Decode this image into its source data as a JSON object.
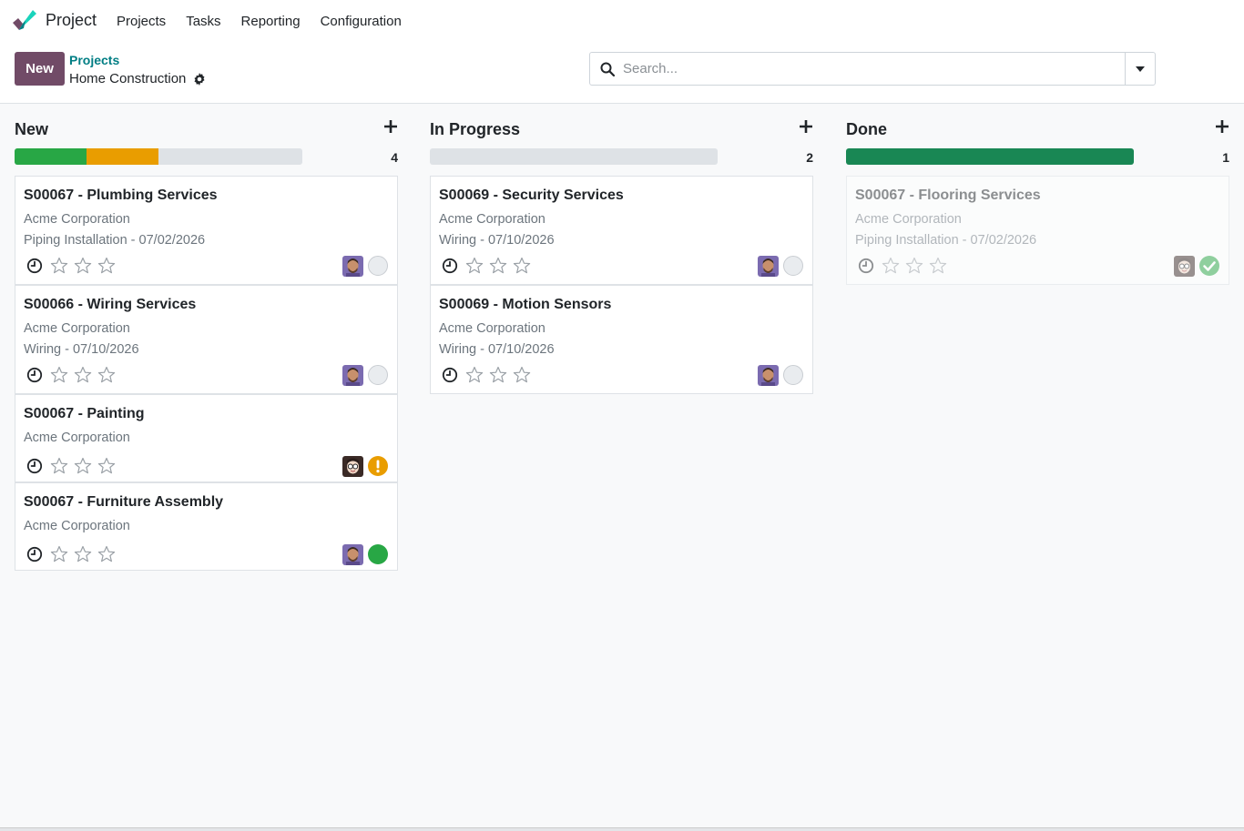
{
  "app": {
    "name": "Project",
    "menu": [
      "Projects",
      "Tasks",
      "Reporting",
      "Configuration"
    ]
  },
  "control": {
    "new_label": "New",
    "breadcrumb_parent": "Projects",
    "breadcrumb_current": "Home Construction",
    "search_placeholder": "Search..."
  },
  "colors": {
    "brand": "#714b67",
    "link": "#017e84",
    "progress_green": "#28a745",
    "progress_orange": "#e99d00",
    "progress_done": "#198754",
    "progress_empty": "#dee2e6"
  },
  "columns": [
    {
      "title": "New",
      "count": "4",
      "progress": [
        {
          "status": "done",
          "fraction": 0.25,
          "color": "#28a745"
        },
        {
          "status": "blocked",
          "fraction": 0.25,
          "color": "#e99d00"
        }
      ],
      "cards": [
        {
          "title": "S00067 - Plumbing Services",
          "partner": "Acme Corporation",
          "subtitle": "Piping Installation - 07/02/2026",
          "avatar": "man",
          "state": "normal"
        },
        {
          "title": "S00066 - Wiring Services",
          "partner": "Acme Corporation",
          "subtitle": "Wiring - 07/10/2026",
          "avatar": "man",
          "state": "normal"
        },
        {
          "title": "S00067 - Painting",
          "partner": "Acme Corporation",
          "subtitle": "",
          "avatar": "glasses",
          "state": "blocked"
        },
        {
          "title": "S00067 - Furniture Assembly",
          "partner": "Acme Corporation",
          "subtitle": "",
          "avatar": "man",
          "state": "done"
        }
      ]
    },
    {
      "title": "In Progress",
      "count": "2",
      "progress": [],
      "cards": [
        {
          "title": "S00069 - Security Services",
          "partner": "Acme Corporation",
          "subtitle": "Wiring - 07/10/2026",
          "avatar": "man",
          "state": "normal"
        },
        {
          "title": "S00069 - Motion Sensors",
          "partner": "Acme Corporation",
          "subtitle": "Wiring - 07/10/2026",
          "avatar": "man",
          "state": "normal"
        }
      ]
    },
    {
      "title": "Done",
      "count": "1",
      "progress": [
        {
          "status": "done",
          "fraction": 1.0,
          "color": "#198754"
        }
      ],
      "cards": [
        {
          "title": "S00067 - Flooring Services",
          "partner": "Acme Corporation",
          "subtitle": "Piping Installation - 07/02/2026",
          "avatar": "glasses",
          "state": "approved",
          "muted": true
        }
      ]
    }
  ]
}
